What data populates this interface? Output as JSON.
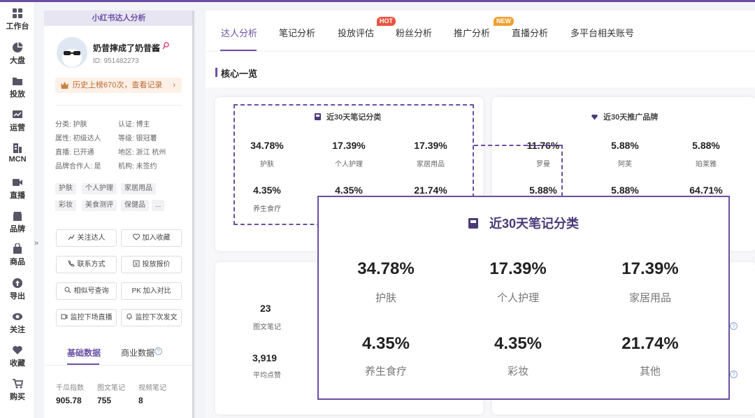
{
  "nav": [
    {
      "label": "工作台",
      "icon": "grid-icon"
    },
    {
      "label": "大盘",
      "icon": "pie-icon"
    },
    {
      "label": "投放",
      "icon": "folder-icon"
    },
    {
      "label": "运营",
      "icon": "chart-icon"
    },
    {
      "label": "MCN",
      "icon": "building-icon"
    },
    {
      "label": "直播",
      "icon": "video-icon"
    },
    {
      "label": "品牌",
      "icon": "store-icon"
    },
    {
      "label": "商品",
      "icon": "bag-icon"
    },
    {
      "label": "导出",
      "icon": "export-icon"
    },
    {
      "label": "关注",
      "icon": "eye-icon"
    },
    {
      "label": "收藏",
      "icon": "heart-icon"
    },
    {
      "label": "购买",
      "icon": "cart-icon"
    }
  ],
  "profile": {
    "header": "小红书达人分析",
    "name": "奶昔摔成了奶昔酱",
    "id": "ID:  951482273",
    "history": "历史上榜670次，查看记录",
    "history_arrow": "›",
    "attrs": [
      "分类: 护肤",
      "认证: 博主",
      "属性: 初级达人",
      "等级: 银冠薯",
      "直播: 已开通",
      "地区: 浙江 杭州",
      "品牌合作人: 是",
      "机构: 未签约"
    ],
    "tags": [
      "护肤",
      "个人护理",
      "家居用品",
      "彩妆",
      "美食测评",
      "保健品",
      "..."
    ],
    "buttons": [
      "关注达人",
      "加入收藏",
      "联系方式",
      "投放报价",
      "相似号查询",
      "PK  加入对比",
      "监控下场直播",
      "监控下次发文"
    ],
    "tabs": [
      "基础数据",
      "商业数据"
    ],
    "stats": [
      {
        "label": "千瓜指数",
        "value": "905.78"
      },
      {
        "label": "图文笔记",
        "value": "755"
      },
      {
        "label": "视频笔记",
        "value": "8"
      }
    ],
    "collapse": "»"
  },
  "main": {
    "tabs": [
      "达人分析",
      "笔记分析",
      "投放评估",
      "粉丝分析",
      "推广分析",
      "直播分析",
      "多平台相关账号"
    ],
    "badges": {
      "hot": "HOT",
      "new": "NEW"
    },
    "section": "核心一览",
    "notes_card": {
      "title": "近30天笔记分类",
      "items": [
        {
          "pct": "34.78%",
          "label": "护肤"
        },
        {
          "pct": "17.39%",
          "label": "个人护理"
        },
        {
          "pct": "17.39%",
          "label": "家居用品"
        },
        {
          "pct": "4.35%",
          "label": "养生食疗"
        },
        {
          "pct": "4.35%",
          "label": "彩妆"
        },
        {
          "pct": "21.74%",
          "label": "其他"
        }
      ]
    },
    "brand_card": {
      "title": "近30天推广品牌",
      "items": [
        {
          "pct": "11.76%",
          "label": "罗曼"
        },
        {
          "pct": "5.88%",
          "label": "阿芙"
        },
        {
          "pct": "5.88%",
          "label": "珀莱雅"
        },
        {
          "pct": "5.88%"
        },
        {
          "pct": "5.88%"
        },
        {
          "pct": "64.71%"
        }
      ]
    },
    "bottom_stats": [
      {
        "value": "23",
        "label": "图文笔记"
      },
      {
        "value": "3,919",
        "label": "平均点赞"
      }
    ]
  },
  "colors": {
    "accent": "#6b4fa3",
    "hot": "#e8553f",
    "new": "#f0a030"
  }
}
